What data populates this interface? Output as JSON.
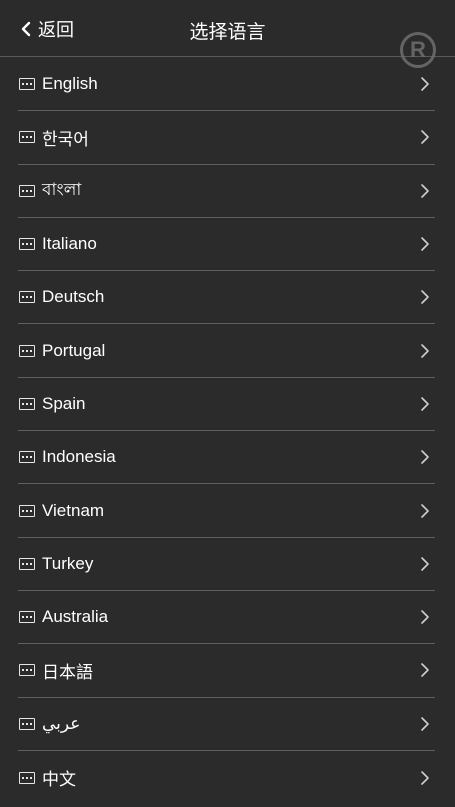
{
  "header": {
    "back_label": "返回",
    "title": "选择语言"
  },
  "watermark": "R",
  "languages": [
    {
      "label": "English"
    },
    {
      "label": "한국어"
    },
    {
      "label": "বাংলা"
    },
    {
      "label": "Italiano"
    },
    {
      "label": "Deutsch"
    },
    {
      "label": "Portugal"
    },
    {
      "label": "Spain"
    },
    {
      "label": "Indonesia"
    },
    {
      "label": "Vietnam"
    },
    {
      "label": "Turkey"
    },
    {
      "label": "Australia"
    },
    {
      "label": "日本語"
    },
    {
      "label": "عربي"
    },
    {
      "label": "中文"
    }
  ],
  "icons": {
    "back": "chevron-left-icon",
    "item": "language-icon",
    "row_arrow": "chevron-right-icon"
  },
  "colors": {
    "background": "#2b2b2b",
    "divider": "#5f5f5f",
    "text": "#ffffff"
  }
}
